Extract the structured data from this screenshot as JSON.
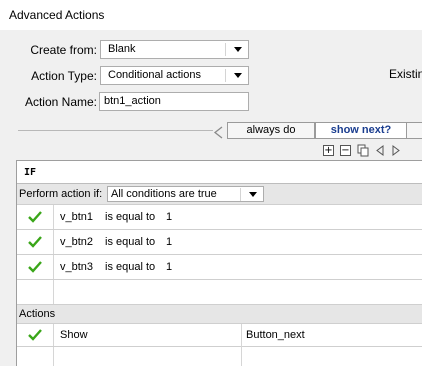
{
  "window": {
    "title": "Advanced Actions"
  },
  "form": {
    "create_from_label": "Create from:",
    "create_from_value": "Blank",
    "action_type_label": "Action Type:",
    "action_type_value": "Conditional actions",
    "action_name_label": "Action Name:",
    "action_name_value": "btn1_action",
    "existing_label": "Existin"
  },
  "decisions": {
    "tabs": [
      {
        "label": "always do",
        "active": false
      },
      {
        "label": "show next?",
        "active": true
      }
    ]
  },
  "toolbar": {
    "icons": [
      "add-icon",
      "remove-icon",
      "copy-icon",
      "arrow-left-icon",
      "arrow-right-icon"
    ]
  },
  "if_section": {
    "header": "IF",
    "perform_label": "Perform action if:",
    "perform_value": "All conditions are true",
    "conditions": [
      {
        "variable": "v_btn1",
        "operator": "is equal to",
        "value": "1"
      },
      {
        "variable": "v_btn2",
        "operator": "is equal to",
        "value": "1"
      },
      {
        "variable": "v_btn3",
        "operator": "is equal to",
        "value": "1"
      }
    ]
  },
  "actions_section": {
    "header": "Actions",
    "rows": [
      {
        "action": "Show",
        "target": "Button_next"
      }
    ]
  },
  "colors": {
    "check_green": "#3aa619",
    "tab_active_text": "#1a3d8f",
    "section_header_bg": "#e6e6e6"
  }
}
